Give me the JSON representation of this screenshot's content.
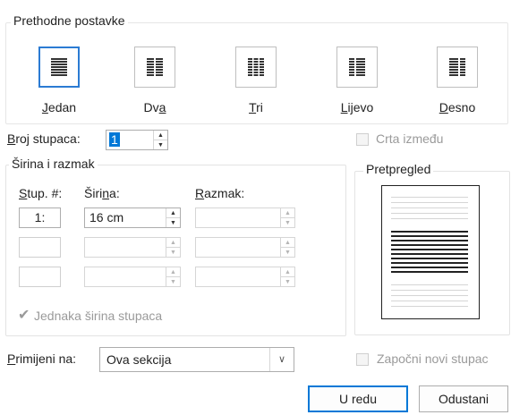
{
  "presets": {
    "legend": "Prethodne postavke",
    "items": [
      {
        "label_pre": "",
        "label_u": "J",
        "label_post": "edan",
        "icon": "one-column-icon"
      },
      {
        "label_pre": "Dv",
        "label_u": "a",
        "label_post": "",
        "icon": "two-columns-icon"
      },
      {
        "label_pre": "",
        "label_u": "T",
        "label_post": "ri",
        "icon": "three-columns-icon"
      },
      {
        "label_pre": "",
        "label_u": "L",
        "label_post": "ijevo",
        "icon": "left-column-icon"
      },
      {
        "label_pre": "",
        "label_u": "D",
        "label_post": "esno",
        "icon": "right-column-icon"
      }
    ],
    "selected_index": 0
  },
  "column_count": {
    "label_u": "B",
    "label_post": "roj stupaca:",
    "value": "1"
  },
  "line_between": {
    "label": "Crta između",
    "checked": false
  },
  "width_spacing": {
    "legend": "Širina i razmak",
    "col_header_u": "S",
    "col_header_post": "tup. #:",
    "width_header_pre": "Širi",
    "width_header_u": "n",
    "width_header_post": "a:",
    "spacing_header_u": "R",
    "spacing_header_post": "azmak:",
    "rows": [
      {
        "col": "1:",
        "width": "16 cm",
        "spacing": ""
      },
      {
        "col": "",
        "width": "",
        "spacing": ""
      },
      {
        "col": "",
        "width": "",
        "spacing": ""
      }
    ],
    "equal_width_label": "Jednaka širina stupaca",
    "equal_width_checked": true
  },
  "preview": {
    "legend": "Pretpregled"
  },
  "apply_to": {
    "label_u": "P",
    "label_post": "rimijeni na:",
    "value": "Ova sekcija"
  },
  "start_new_column": {
    "label": "Započni novi stupac",
    "checked": false
  },
  "buttons": {
    "ok": "U redu",
    "cancel": "Odustani"
  },
  "colors": {
    "accent": "#0078d7",
    "selected_preset_border": "#2b7bd3",
    "disabled_text": "#9a9a9a"
  }
}
